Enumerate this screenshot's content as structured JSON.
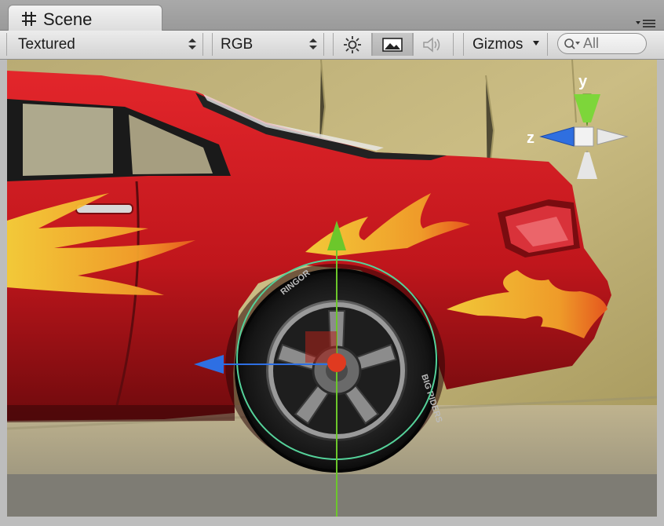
{
  "window": {
    "tab_title": "Scene"
  },
  "toolbar": {
    "render_mode": "Textured",
    "channel_mode": "RGB",
    "lighting_icon": "sun-icon",
    "image_icon": "image-icon",
    "audio_icon": "speaker-icon",
    "gizmos_label": "Gizmos",
    "search_placeholder": "All"
  },
  "scene_gizmo": {
    "y_label": "y",
    "z_label": "z",
    "axis_colors": {
      "y": "#7dd63a",
      "z": "#2f6fe0",
      "other": "#e8e8e8"
    }
  },
  "transform_handle": {
    "colors": {
      "y": "#6cc72b",
      "z": "#2e6fe3",
      "center": "#e03a20",
      "rotation_ring": "#55d29a"
    }
  },
  "tire_text": [
    "RINGOR",
    "BIG RIDERS"
  ],
  "colors": {
    "car_body": "#c8181e",
    "flame": "#f2c02a",
    "wall": "#bfae72",
    "toolbar_bg": "#dedede"
  }
}
